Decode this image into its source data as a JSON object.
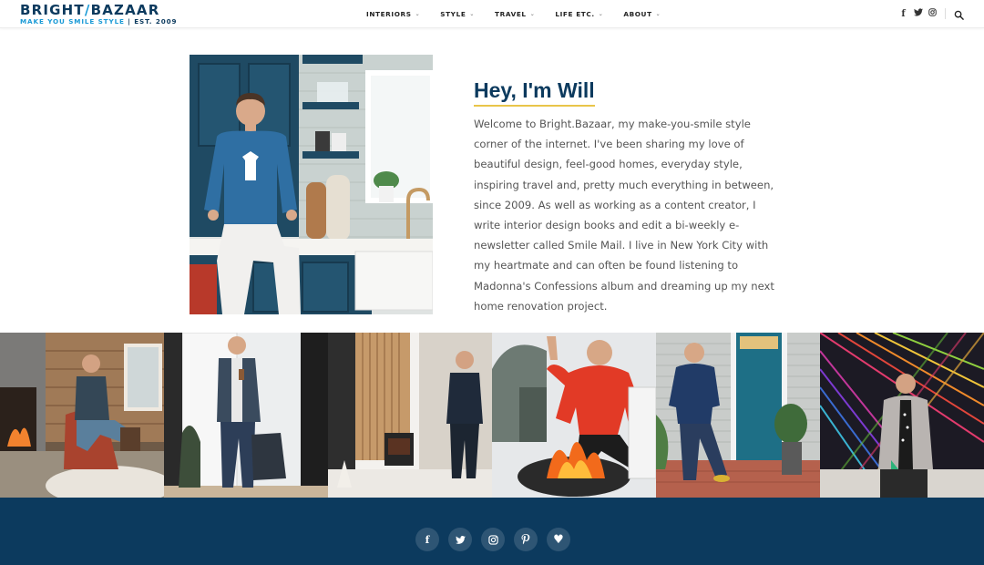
{
  "header": {
    "logo": {
      "part1": "BRIGHT",
      "slash": "/",
      "part2": "BAZAAR",
      "tagline": "MAKE YOU SMILE STYLE",
      "est": "| EST. 2009"
    },
    "nav": [
      {
        "label": "INTERIORS"
      },
      {
        "label": "STYLE"
      },
      {
        "label": "TRAVEL"
      },
      {
        "label": "LIFE ETC."
      },
      {
        "label": "ABOUT"
      }
    ],
    "chevron": "⌄",
    "social": {
      "facebook": "f",
      "twitter": "t",
      "instagram": "◎"
    }
  },
  "hero": {
    "title": "Hey, I'm Will",
    "body": "Welcome to Bright.Bazaar, my make-you-smile style corner of the internet. I've been sharing my love of beautiful design, feel-good homes, everyday style, inspiring travel and, pretty much everything in between, since 2009. As well as working as a content creator, I write interior design books and edit a bi-weekly e-newsletter called Smile Mail. I live in New York City with my heartmate and can often be found listening to Madonna's Confessions album and dreaming up my next home renovation project."
  },
  "gallery": [
    {
      "name": "photo-fireplace-chair"
    },
    {
      "name": "photo-white-door-bag"
    },
    {
      "name": "photo-wood-slat-stove"
    },
    {
      "name": "photo-red-jacket-firepit"
    },
    {
      "name": "photo-blue-door-sweater"
    },
    {
      "name": "photo-string-art-coat"
    }
  ],
  "footer": {
    "icons": [
      {
        "name": "facebook-icon",
        "glyph": "f"
      },
      {
        "name": "twitter-icon",
        "glyph": "t"
      },
      {
        "name": "instagram-icon",
        "glyph": "◎"
      },
      {
        "name": "pinterest-icon",
        "glyph": "p"
      },
      {
        "name": "heart-icon",
        "glyph": "♥"
      }
    ]
  },
  "colors": {
    "navy": "#0c3a5e",
    "accent_blue": "#1a9ad6",
    "underline_gold": "#e9c54a"
  }
}
